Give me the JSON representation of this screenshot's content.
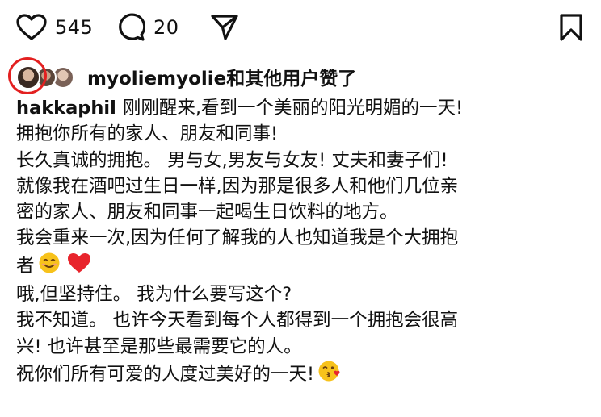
{
  "actions": {
    "like_count": "545",
    "comment_count": "20",
    "icons": [
      "heart-icon",
      "comment-icon",
      "share-icon",
      "bookmark-icon"
    ]
  },
  "likes": {
    "user": "myoliemyolie",
    "suffix": "和其他用户赞了"
  },
  "caption": {
    "username": "hakkaphil",
    "line1": "刚刚醒来,看到一个美丽的阳光明媚的一天!",
    "line2": "拥抱你所有的家人、朋友和同事!",
    "line3": "长久真诚的拥抱。 男与女,男友与女友! 丈夫和妻子们!",
    "line4": "就像我在酒吧过生日一样,因为那是很多人和他们几位亲",
    "line5": "密的家人、朋友和同事一起喝生日饮料的地方。",
    "line6": "我会重来一次,因为任何了解我的人也知道我是个大拥抱",
    "line7": "者",
    "line8": "哦,但坚持住。 我为什么要写这个?",
    "line9": "我不知道。 也许今天看到每个人都得到一个拥抱会很高",
    "line10": "兴! 也许甚至是那些最需要它的人。",
    "line11": "祝你们所有可爱的人度过美好的一天!"
  },
  "colors": {
    "text": "#111111",
    "highlight_ring": "#e32020",
    "heart_emoji": "#e8242c",
    "smile_emoji": "#f7c21b"
  }
}
